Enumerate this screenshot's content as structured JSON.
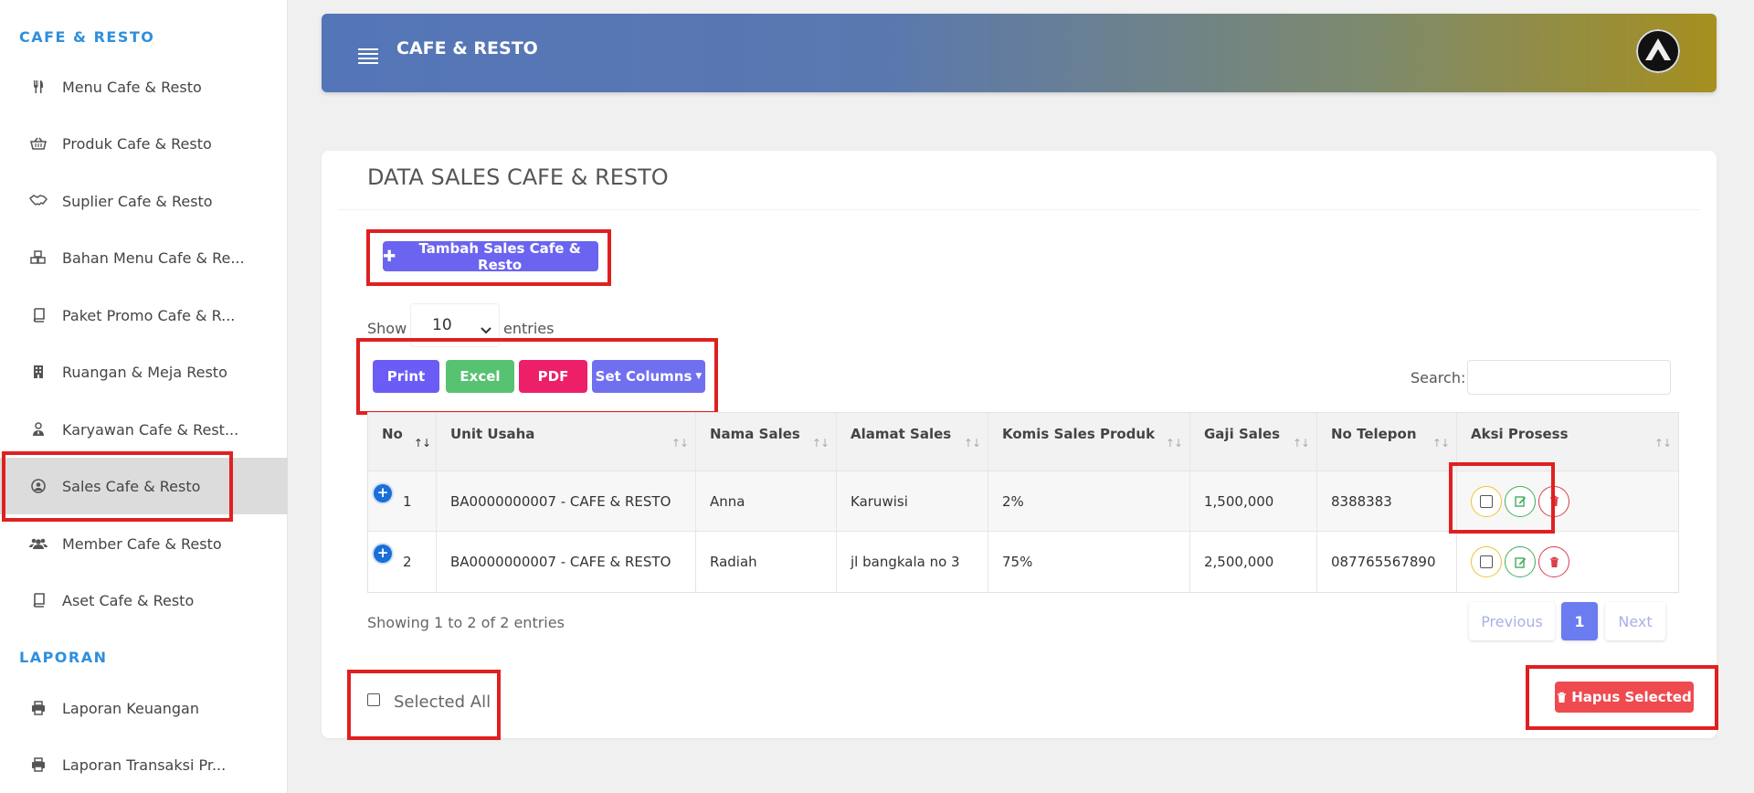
{
  "sidebar": {
    "section_cafe": "CAFE & RESTO",
    "items": [
      {
        "label": "Menu Cafe & Resto",
        "icon": "utensils-icon"
      },
      {
        "label": "Produk Cafe & Resto",
        "icon": "basket-icon"
      },
      {
        "label": "Suplier Cafe & Resto",
        "icon": "handshake-icon"
      },
      {
        "label": "Bahan Menu Cafe & Re...",
        "icon": "cubes-icon"
      },
      {
        "label": "Paket Promo Cafe & R...",
        "icon": "book-icon"
      },
      {
        "label": "Ruangan & Meja Resto",
        "icon": "building-icon"
      },
      {
        "label": "Karyawan Cafe & Rest...",
        "icon": "user-tie-icon"
      },
      {
        "label": "Sales Cafe & Resto",
        "icon": "user-circle-icon",
        "active": true
      },
      {
        "label": "Member Cafe & Resto",
        "icon": "users-icon"
      },
      {
        "label": "Aset Cafe & Resto",
        "icon": "book-icon"
      }
    ],
    "section_laporan": "LAPORAN",
    "laporan_items": [
      {
        "label": "Laporan Keuangan",
        "icon": "print-icon"
      },
      {
        "label": "Laporan Transaksi Pr...",
        "icon": "print-icon"
      }
    ]
  },
  "header": {
    "title": "CAFE & RESTO"
  },
  "card": {
    "title": "DATA SALES CAFE & RESTO",
    "add_button": "Tambah Sales Cafe & Resto",
    "show_label": "Show",
    "entries_value": "10",
    "entries_label": "entries",
    "export_buttons": {
      "print": "Print",
      "excel": "Excel",
      "pdf": "PDF",
      "set_columns": "Set Columns"
    },
    "search_label": "Search:",
    "search_value": ""
  },
  "table": {
    "columns": [
      "No",
      "Unit Usaha",
      "Nama Sales",
      "Alamat Sales",
      "Komis Sales Produk",
      "Gaji Sales",
      "No Telepon",
      "Aksi Prosess"
    ],
    "rows": [
      {
        "no": "1",
        "unit": "BA0000000007 - CAFE & RESTO",
        "nama": "Anna",
        "alamat": "Karuwisi",
        "komisi": "2%",
        "gaji": "1,500,000",
        "telp": "8388383"
      },
      {
        "no": "2",
        "unit": "BA0000000007 - CAFE & RESTO",
        "nama": "Radiah",
        "alamat": "jl bangkala no 3",
        "komisi": "75%",
        "gaji": "2,500,000",
        "telp": "087765567890"
      }
    ]
  },
  "footer": {
    "showing": "Showing 1 to 2 of 2 entries",
    "prev": "Previous",
    "page": "1",
    "next": "Next",
    "selected_all": "Selected All",
    "hapus_selected": "Hapus Selected"
  }
}
